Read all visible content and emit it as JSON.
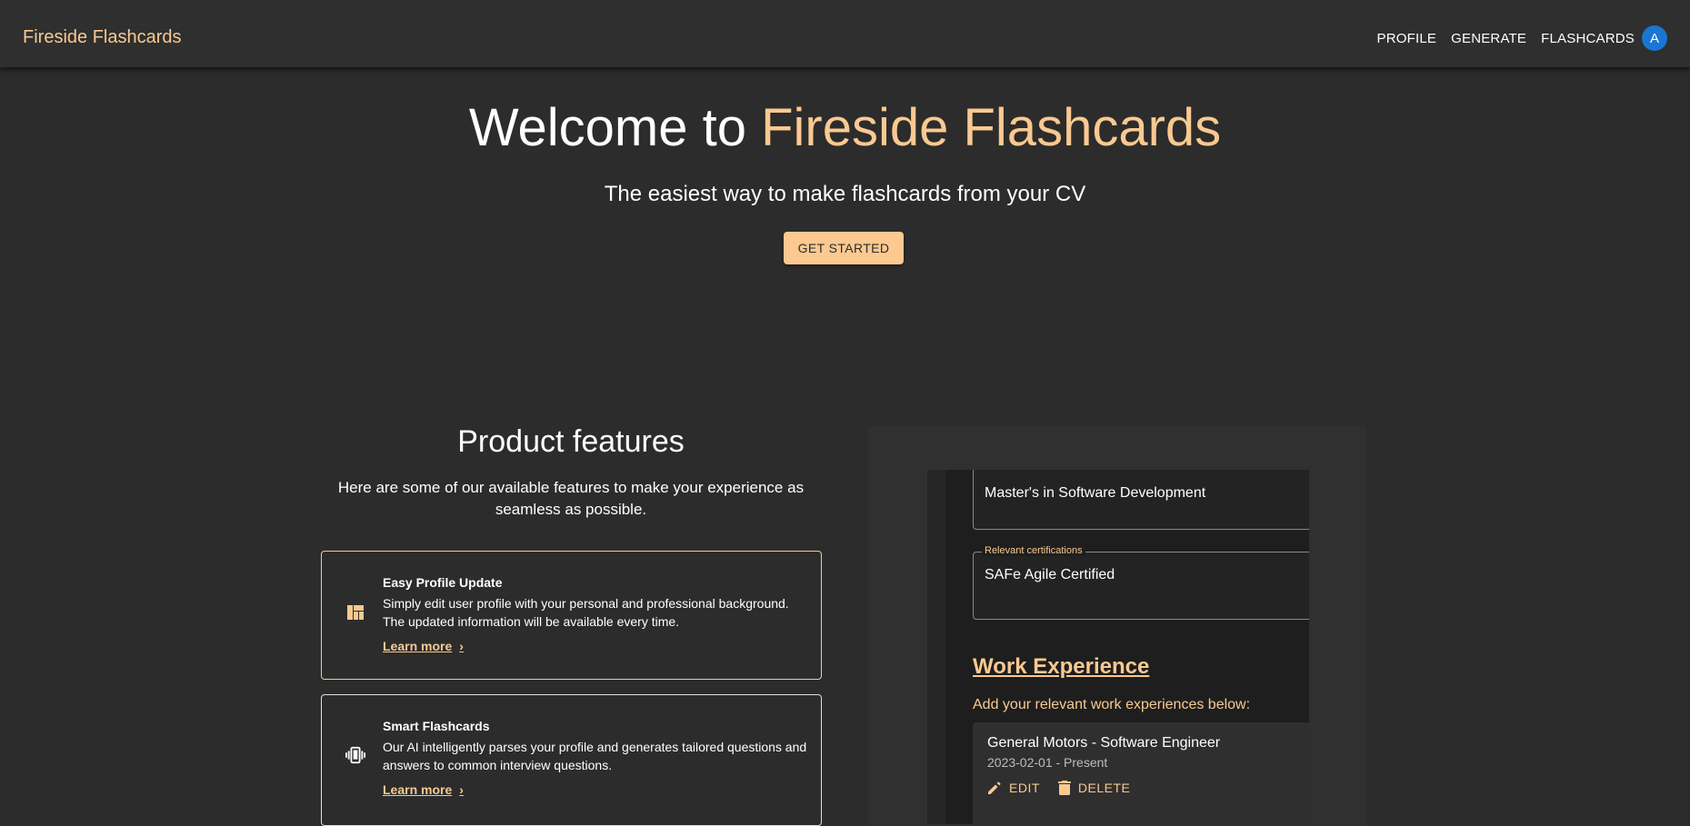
{
  "app": {
    "brand": "Fireside Flashcards",
    "nav": [
      "PROFILE",
      "GENERATE",
      "FLASHCARDS"
    ],
    "avatar_letter": "A"
  },
  "hero": {
    "title_prefix": "Welcome to ",
    "title_accent": "Fireside Flashcards",
    "subtitle": "The easiest way to make flashcards from your CV",
    "cta": "GET STARTED"
  },
  "features": {
    "title": "Product features",
    "description": "Here are some of our available features to make your experience as seamless as possible.",
    "items": [
      {
        "icon": "dashboard-icon",
        "title": "Easy Profile Update",
        "description": "Simply edit user profile with your personal and professional background. The updated information will be available every time.",
        "link": "Learn more"
      },
      {
        "icon": "vibration-phone-icon",
        "title": "Smart Flashcards",
        "description": "Our AI intelligently parses your profile and generates tailored questions and answers to common interview questions.",
        "link": "Learn more"
      }
    ]
  },
  "preview": {
    "education_value": "Master's in Software Development",
    "cert_label": "Relevant certifications",
    "cert_value": "SAFe Agile Certified",
    "work_heading": "Work Experience",
    "work_sub": "Add your relevant work experiences below:",
    "experience": {
      "title": "General Motors - Software Engineer",
      "dates": "2023-02-01 - Present",
      "edit": "EDIT",
      "delete": "DELETE"
    }
  },
  "colors": {
    "accent": "#f9c991",
    "background": "#2c2c2c",
    "avatar": "#1976d2"
  }
}
